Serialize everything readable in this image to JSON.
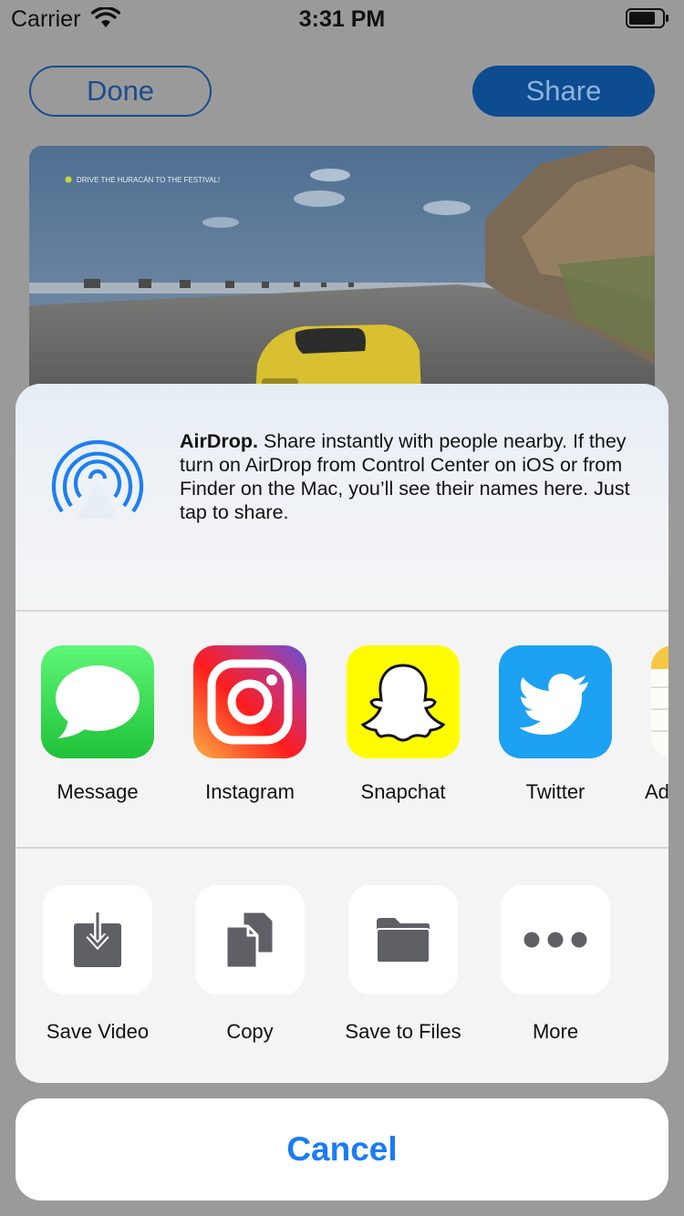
{
  "status_bar": {
    "carrier": "Carrier",
    "time": "3:31 PM"
  },
  "top_bar": {
    "done_label": "Done",
    "share_label": "Share"
  },
  "preview": {
    "overlay_text": "DRIVE THE HURACÁN TO THE FESTIVAL!"
  },
  "airdrop": {
    "title": "AirDrop.",
    "description": " Share instantly with people nearby. If they turn on AirDrop from Control Center on iOS or from Finder on the Mac, you’ll see their names here. Just tap to share."
  },
  "apps": [
    {
      "label": "Message",
      "icon": "messages-icon"
    },
    {
      "label": "Instagram",
      "icon": "instagram-icon"
    },
    {
      "label": "Snapchat",
      "icon": "snapchat-icon"
    },
    {
      "label": "Twitter",
      "icon": "twitter-icon"
    },
    {
      "label": "Ad",
      "icon": "notes-icon"
    }
  ],
  "actions": [
    {
      "label": "Save Video",
      "icon": "save-video-icon"
    },
    {
      "label": "Copy",
      "icon": "copy-icon"
    },
    {
      "label": "Save to Files",
      "icon": "folder-icon"
    },
    {
      "label": "More",
      "icon": "more-icon"
    }
  ],
  "cancel_label": "Cancel",
  "colors": {
    "accent": "#1a7cf5",
    "messages_green": "#2fcb4a",
    "snapchat_yellow": "#fffc00",
    "twitter_blue": "#1da1f2",
    "action_icon_gray": "#5f5f66"
  }
}
